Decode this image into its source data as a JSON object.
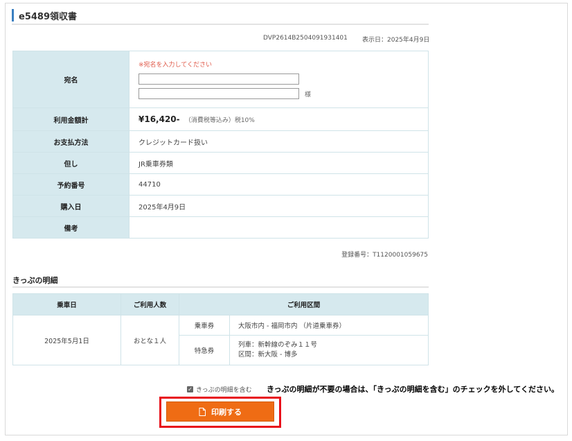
{
  "header": {
    "title": "e5489領収書",
    "receipt_id": "DVP2614B2504091931401",
    "display_date": "表示日：2025年4月9日"
  },
  "receipt": {
    "addressee_label": "宛名",
    "addressee_warning": "※宛名を入力してください",
    "addressee_line1": "",
    "addressee_line2": "",
    "honorific": "様",
    "amount_label": "利用金額計",
    "amount_value": "¥16,420-",
    "amount_tax_note": "（消費税等込み）税10%",
    "payment_label": "お支払方法",
    "payment_value": "クレジットカード扱い",
    "purpose_label": "但し",
    "purpose_value": "JR乗車券類",
    "reservation_label": "予約番号",
    "reservation_value": "44710",
    "purchase_date_label": "購入日",
    "purchase_date_value": "2025年4月9日",
    "remarks_label": "備考",
    "remarks_value": ""
  },
  "registration": "登録番号：T1120001059675",
  "tickets": {
    "section_title": "きっぷの明細",
    "headers": [
      "乗車日",
      "ご利用人数",
      "ご利用区間"
    ],
    "date": "2025年5月1日",
    "passengers": "おとな１人",
    "rows": [
      {
        "type": "乗車券",
        "detail1": "大阪市内 - 福岡市内 （片道乗車券）",
        "detail2": ""
      },
      {
        "type": "特急券",
        "detail1": "列車：新幹線のぞみ１１号",
        "detail2": "区間：新大阪 - 博多"
      }
    ]
  },
  "footer": {
    "include_tickets_label": "きっぷの明細を含む",
    "include_tickets_checked": true,
    "instruction_note": "きっぷの明細が不要の場合は、「きっぷの明細を含む」のチェックを外してください。",
    "print_button_label": "印刷する"
  },
  "colors": {
    "accent_blue": "#3a7fc1",
    "table_header_bg": "#d6e9ee",
    "print_button": "#ef6c14",
    "highlight_border": "#e8101a",
    "warning_text": "#e05a4a"
  }
}
